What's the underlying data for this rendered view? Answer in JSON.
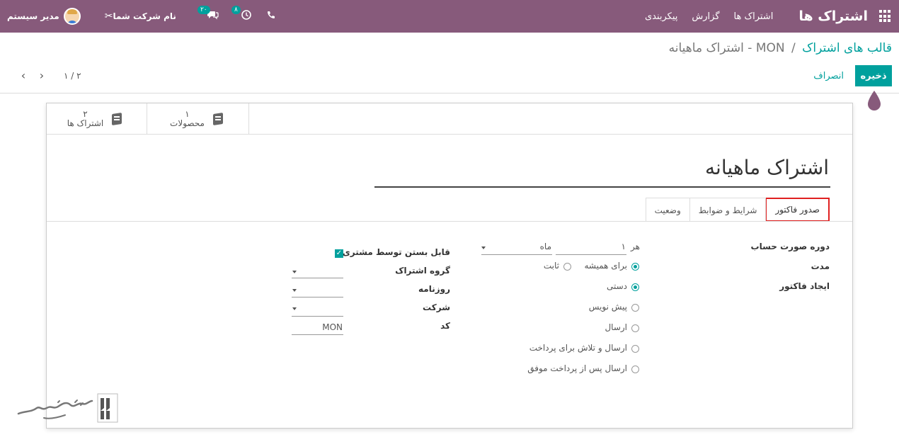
{
  "navbar": {
    "brand": "اشتراک ها",
    "menu": [
      "اشتراک ها",
      "گزارش",
      "پیکربندی"
    ],
    "company": "نام شرکت شما",
    "user": "مدیر سیستم",
    "activity_count": "۸",
    "message_count": "۲۰",
    "icons": [
      "apps-icon",
      "phone-icon",
      "clock-icon",
      "chat-icon",
      "tools-icon"
    ]
  },
  "breadcrumb": {
    "parent": "قالب های اشتراک",
    "separator": "/",
    "current": "MON - اشتراک ماهیانه"
  },
  "actions": {
    "save": "ذخیره",
    "discard": "انصراف"
  },
  "pager": {
    "value": "۱ / ۲",
    "prev": "‹",
    "next": "›"
  },
  "stat_buttons": [
    {
      "count": "۱",
      "label": "محصولات"
    },
    {
      "count": "۲",
      "label": "اشتراک ها"
    }
  ],
  "form": {
    "title": "اشتراک ماهیانه",
    "tabs": [
      "صدور فاکتور",
      "شرایط و ضوابط",
      "وضعیت"
    ],
    "active_tab": "صدور فاکتور",
    "billing_period_label": "دوره صورت حساب",
    "every_label": "هر",
    "every_value": "۱",
    "period_unit": "ماه",
    "duration_label": "مدت",
    "duration_options": [
      "برای همیشه",
      "ثابت"
    ],
    "duration_selected": "برای همیشه",
    "invoicing_label": "ایجاد فاکتور",
    "invoicing_options": [
      "دستی",
      "پیش نویس",
      "ارسال",
      "ارسال و تلاش برای پرداخت",
      "ارسال پس از پرداخت موفق"
    ],
    "invoicing_selected": "دستی",
    "closable_label": "قابل بستن توسط مشتری",
    "closable_checked": true,
    "subscription_group_label": "گروه اشتراک",
    "journal_label": "روزنامه",
    "company_label": "شرکت",
    "code_label": "کد",
    "code_value": "MON"
  }
}
